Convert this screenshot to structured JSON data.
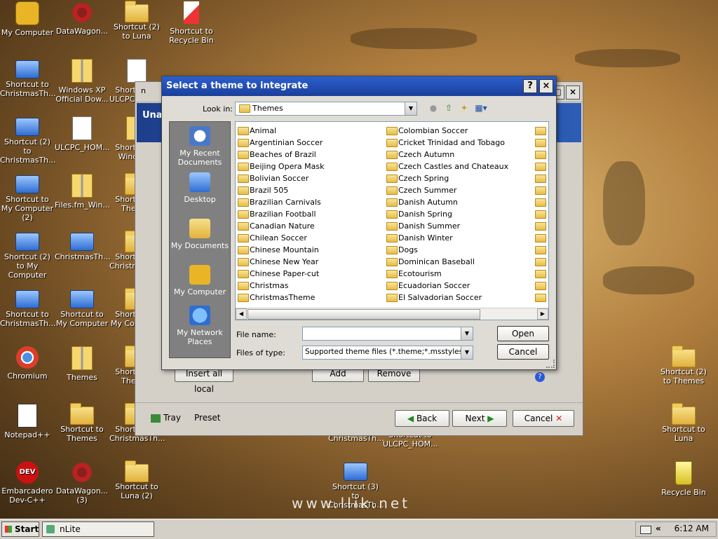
{
  "desktop": {
    "icons": [
      {
        "label": "My Computer",
        "type": "puzzle"
      },
      {
        "label": "DataWagon...",
        "type": "web"
      },
      {
        "label": "Shortcut (2) to Luna",
        "type": "folder"
      },
      {
        "label": "Shortcut to Recycle Bin",
        "type": "sail"
      },
      {
        "label": "Shortcut to ChristmasTh...",
        "type": "pc"
      },
      {
        "label": "Windows XP Official Dow...",
        "type": "zip"
      },
      {
        "label": "Shortcut to ULCPC_HOM...",
        "type": "doc"
      },
      {
        "label": "Shortcut (2) to ChristmasTh...",
        "type": "pc"
      },
      {
        "label": "ULCPC_HOM...",
        "type": "doc"
      },
      {
        "label": "Shortcut to Window...",
        "type": "zip"
      },
      {
        "label": "Shortcut to My Computer (2)",
        "type": "pc"
      },
      {
        "label": "Files.fm_Win...",
        "type": "zip"
      },
      {
        "label": "Shortcut to Themes",
        "type": "folder"
      },
      {
        "label": "Shortcut (2) to My Computer",
        "type": "pc"
      },
      {
        "label": "ChristmasTh...",
        "type": "pc"
      },
      {
        "label": "Shortcut to ChristmasTh...",
        "type": "folder"
      },
      {
        "label": "Shortcut to ChristmasTh...",
        "type": "pc"
      },
      {
        "label": "Shortcut to My Computer",
        "type": "pc"
      },
      {
        "label": "Shortcut to My Computer",
        "type": "folder"
      },
      {
        "label": "Chromium",
        "type": "chrome"
      },
      {
        "label": "Themes",
        "type": "zip"
      },
      {
        "label": "Shortcut to Themes",
        "type": "folder"
      },
      {
        "label": "Notepad++",
        "type": "np"
      },
      {
        "label": "Shortcut to Themes",
        "type": "folder"
      },
      {
        "label": "Shortcut to ChristmasTh...",
        "type": "folder"
      },
      {
        "label": "Embarcadero Dev-C++",
        "type": "dev"
      },
      {
        "label": "DataWagon... (3)",
        "type": "web"
      },
      {
        "label": "Shortcut to Luna (2)",
        "type": "folder"
      },
      {
        "label": "Shortcut to ChristmasTh...",
        "type": "folder"
      },
      {
        "label": "Shortcut to ULCPC_HOM...",
        "type": "doc"
      },
      {
        "label": "Shortcut (3) to ChristmasTh...",
        "type": "pc"
      },
      {
        "label": "Shortcut (2) to Themes",
        "type": "folder"
      },
      {
        "label": "Shortcut to Luna",
        "type": "folder"
      },
      {
        "label": "Recycle Bin",
        "type": "bin"
      }
    ],
    "watermark": "www.llik.net"
  },
  "nlite": {
    "title_short": "n",
    "header_text": "Unat",
    "buttons": {
      "insert_all_local": "Insert all local",
      "add": "Add",
      "remove": "Remove",
      "tray": "Tray",
      "preset": "Preset",
      "back": "Back",
      "next": "Next",
      "cancel": "Cancel"
    }
  },
  "dialog": {
    "title": "Select a theme to integrate",
    "help_btn": "?",
    "close_btn": "×",
    "look_in_label": "Look in:",
    "look_in_value": "Themes",
    "places": [
      "My Recent Documents",
      "Desktop",
      "My Documents",
      "My Computer",
      "My Network Places"
    ],
    "folders_col1": [
      "Animal",
      "Argentinian Soccer",
      "Beaches of Brazil",
      "Beijing Opera Mask",
      "Bolivian Soccer",
      "Brazil 505",
      "Brazilian Carnivals",
      "Brazilian Football",
      "Canadian Nature",
      "Chilean Soccer",
      "Chinese Mountain",
      "Chinese New Year",
      "Chinese Paper-cut",
      "Christmas",
      "ChristmasTheme"
    ],
    "folders_col2": [
      "Colombian Soccer",
      "Cricket Trinidad and Tobago",
      "Czech Autumn",
      "Czech Castles and Chateaux",
      "Czech Spring",
      "Czech Summer",
      "Danish Autumn",
      "Danish Spring",
      "Danish Summer",
      "Danish Winter",
      "Dogs",
      "Dominican Baseball",
      "Ecotourism",
      "Ecuadorian Soccer",
      "El Salvadorian Soccer"
    ],
    "file_name_label": "File name:",
    "file_name_value": "",
    "files_of_type_label": "Files of type:",
    "files_of_type_value": "Supported theme files (*.theme;*.msstyles)",
    "open_btn": "Open",
    "cancel_btn": "Cancel"
  },
  "taskbar": {
    "start": "Start",
    "task": "nLite",
    "clock": "6:12 AM",
    "chevron": "«"
  }
}
